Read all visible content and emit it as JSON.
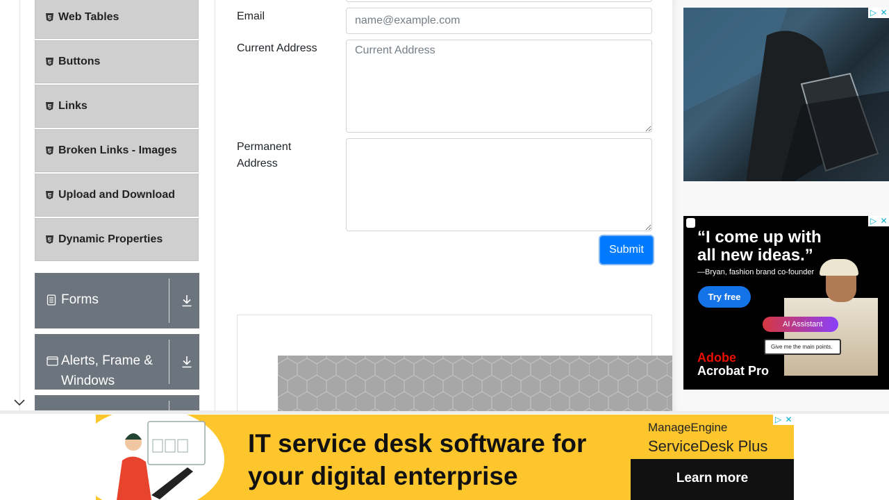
{
  "sidebar": {
    "items": [
      {
        "label": "Web Tables"
      },
      {
        "label": "Buttons"
      },
      {
        "label": "Links"
      },
      {
        "label": "Broken Links - Images"
      },
      {
        "label": "Upload and Download"
      },
      {
        "label": "Dynamic Properties"
      }
    ],
    "groups": [
      {
        "label": "Forms",
        "icon": "document-icon"
      },
      {
        "label": "Alerts, Frame & Windows",
        "icon": "window-icon"
      }
    ]
  },
  "form": {
    "email_label": "Email",
    "email_placeholder": "name@example.com",
    "current_address_label": "Current Address",
    "current_address_placeholder": "Current Address",
    "permanent_address_label": "Permanent Address",
    "submit_label": "Submit"
  },
  "ads": {
    "adobe": {
      "quote": "“I come up with all new ideas.”",
      "attribution": "—Bryan, fashion brand co-founder",
      "cta": "Try free",
      "ai_label": "AI Assistant",
      "prompt": "Give me the main points.",
      "brand_line1": "Adobe",
      "brand_line2": "Acrobat Pro"
    },
    "banner": {
      "headline": "IT service desk software for your digital enterprise",
      "company": "ManageEngine",
      "product": "ServiceDesk Plus",
      "cta": "Learn more"
    }
  },
  "colors": {
    "accent": "#007bff",
    "menu_bg": "#cfcfcf",
    "group_bg": "#6c757d",
    "banner_bg": "#fdc62d"
  }
}
